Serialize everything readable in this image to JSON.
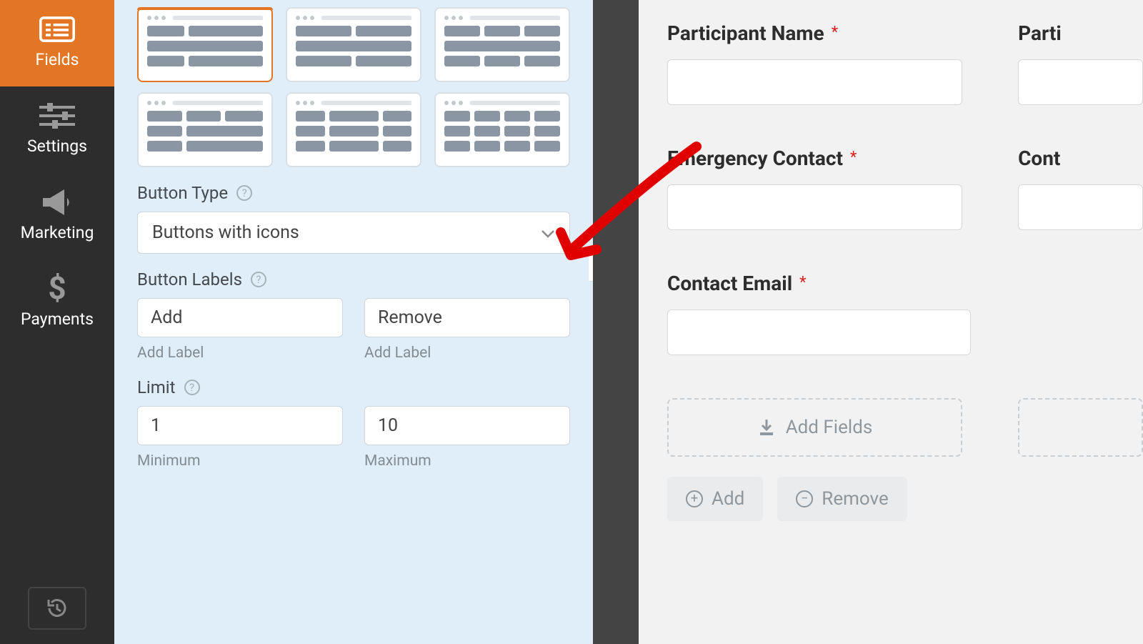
{
  "sidebar": {
    "fields": "Fields",
    "settings": "Settings",
    "marketing": "Marketing",
    "payments": "Payments"
  },
  "panel": {
    "button_type_label": "Button Type",
    "button_type_value": "Buttons with icons",
    "button_labels_label": "Button Labels",
    "add_value": "Add",
    "remove_value": "Remove",
    "add_hint": "Add Label",
    "remove_hint": "Add Label",
    "limit_label": "Limit",
    "min_value": "1",
    "max_value": "10",
    "min_hint": "Minimum",
    "max_hint": "Maximum"
  },
  "preview": {
    "participant_name": "Participant Name",
    "partic_cut": "Parti",
    "emergency_contact": "Emergency Contact",
    "cont_cut": "Cont",
    "contact_email": "Contact Email",
    "add_fields": "Add Fields",
    "add_btn": "Add",
    "remove_btn": "Remove"
  }
}
